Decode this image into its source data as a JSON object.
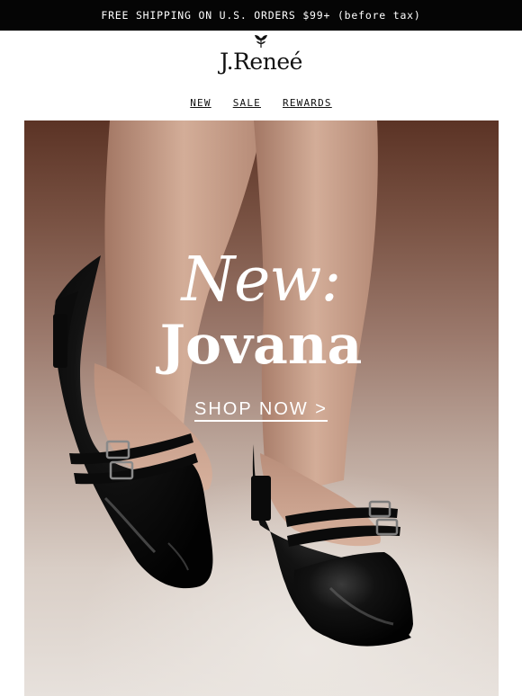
{
  "topbar": {
    "text": "FREE SHIPPING ON U.S. ORDERS $99+ (before tax)"
  },
  "brand": {
    "name": "J.Reneé",
    "logo_icon": "leaf-flower-icon"
  },
  "nav": {
    "items": [
      "NEW",
      "SALE",
      "REWARDS"
    ]
  },
  "hero": {
    "title_line1": "New:",
    "title_line2": "Jovana",
    "cta": "SHOP NOW >",
    "image_subject": "black patent slingback mary jane shoes"
  },
  "colors": {
    "topbar_bg": "#050505",
    "hero_text": "#ffffff"
  }
}
